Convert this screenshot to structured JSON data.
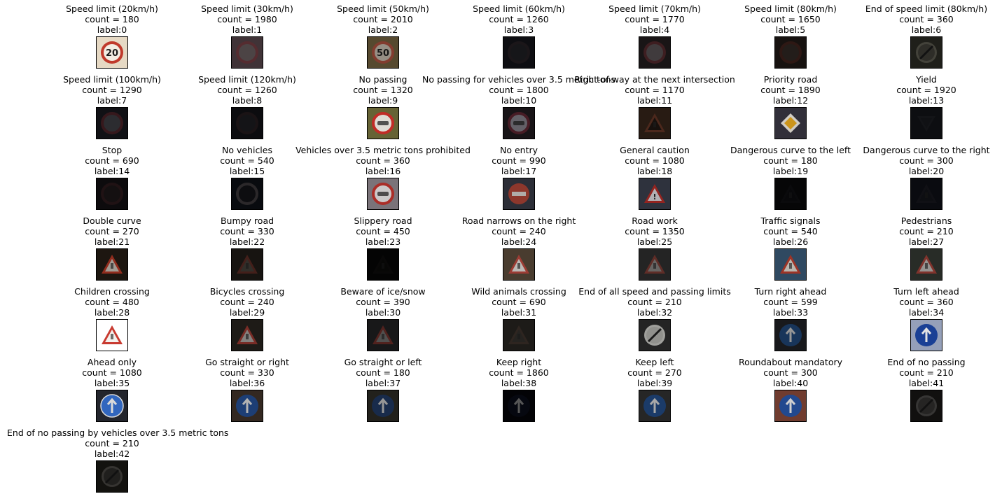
{
  "title": "",
  "columns": 7,
  "classes": [
    {
      "name": "Speed limit (20km/h)",
      "count_text": "count = 180",
      "label_text": "label:0",
      "icon": "speed-limit-sign-icon",
      "bg": "#e6d9c4",
      "fg": "#c0392b",
      "inner": "#f3ede3",
      "glyph": "20",
      "lum": 1.0
    },
    {
      "name": "Speed limit (30km/h)",
      "count_text": "count = 1980",
      "label_text": "label:1",
      "icon": "speed-limit-sign-icon",
      "bg": "#5c4a4f",
      "fg": "#7a3f46",
      "inner": "#6e6264",
      "glyph": "",
      "lum": 0.6
    },
    {
      "name": "Speed limit (50km/h)",
      "count_text": "count = 2010",
      "label_text": "label:2",
      "icon": "speed-limit-sign-icon",
      "bg": "#6b5a3a",
      "fg": "#a04a3a",
      "inner": "#b9b0a4",
      "glyph": "50",
      "lum": 0.75
    },
    {
      "name": "Speed limit (60km/h)",
      "count_text": "count = 1260",
      "label_text": "label:3",
      "icon": "speed-limit-sign-icon",
      "bg": "#1f1f26",
      "fg": "#3a2f36",
      "inner": "#2e2e35",
      "glyph": "",
      "lum": 0.3
    },
    {
      "name": "Speed limit (70km/h)",
      "count_text": "count = 1770",
      "label_text": "label:4",
      "icon": "speed-limit-sign-icon",
      "bg": "#2c2426",
      "fg": "#6a3438",
      "inner": "#6e6569",
      "glyph": "",
      "lum": 0.45
    },
    {
      "name": "Speed limit (80km/h)",
      "count_text": "count = 1650",
      "label_text": "label:5",
      "icon": "speed-limit-sign-icon",
      "bg": "#2e2420",
      "fg": "#5a2f28",
      "inner": "#453a34",
      "glyph": "",
      "lum": 0.35
    },
    {
      "name": "End of speed limit (80km/h)",
      "count_text": "count = 360",
      "label_text": "label:6",
      "icon": "end-of-speed-limit-sign-icon",
      "bg": "#3a3a30",
      "fg": "#7a786a",
      "inner": "#55524a",
      "glyph": "",
      "lum": 0.4
    },
    {
      "name": "Speed limit (100km/h)",
      "count_text": "count = 1290",
      "label_text": "label:7",
      "icon": "speed-limit-sign-icon",
      "bg": "#22232a",
      "fg": "#6b3038",
      "inner": "#56565e",
      "glyph": "",
      "lum": 0.35
    },
    {
      "name": "Speed limit (120km/h)",
      "count_text": "count = 1260",
      "label_text": "label:8",
      "icon": "speed-limit-sign-icon",
      "bg": "#1d1d22",
      "fg": "#3d2c30",
      "inner": "#2f2f35",
      "glyph": "",
      "lum": 0.25
    },
    {
      "name": "No passing",
      "count_text": "count = 1320",
      "label_text": "label:9",
      "icon": "no-passing-sign-icon",
      "bg": "#6e6b3a",
      "fg": "#d0302a",
      "inner": "#f0ece6",
      "glyph": "",
      "lum": 0.9
    },
    {
      "name": "No passing for vehicles over 3.5 metric tons",
      "count_text": "count = 1800",
      "label_text": "label:10",
      "icon": "no-passing-trucks-sign-icon",
      "bg": "#2a2228",
      "fg": "#7a3040",
      "inner": "#a8a4b0",
      "glyph": "",
      "lum": 0.45
    },
    {
      "name": "Right-of-way at the next intersection",
      "count_text": "count = 1170",
      "label_text": "label:11",
      "icon": "right-of-way-sign-icon",
      "bg": "#4a3224",
      "fg": "#8a4a34",
      "inner": "#2a1e18",
      "glyph": "",
      "lum": 0.4
    },
    {
      "name": "Priority road",
      "count_text": "count = 1890",
      "label_text": "label:12",
      "icon": "priority-road-sign-icon",
      "bg": "#3a3844",
      "fg": "#f5f0e6",
      "inner": "#f0b020",
      "glyph": "",
      "lum": 0.8
    },
    {
      "name": "Yield",
      "count_text": "count = 1920",
      "label_text": "label:13",
      "icon": "yield-sign-icon",
      "bg": "#1e2028",
      "fg": "#2c2e36",
      "inner": "#25272f",
      "glyph": "",
      "lum": 0.25
    },
    {
      "name": "Stop",
      "count_text": "count = 690",
      "label_text": "label:14",
      "icon": "stop-sign-icon",
      "bg": "#1e1a1e",
      "fg": "#4a2a2e",
      "inner": "#2e2628",
      "glyph": "",
      "lum": 0.25
    },
    {
      "name": "No vehicles",
      "count_text": "count = 540",
      "label_text": "label:15",
      "icon": "no-vehicles-sign-icon",
      "bg": "#141820",
      "fg": "#5a5458",
      "inner": "#1c1c22",
      "glyph": "",
      "lum": 0.3
    },
    {
      "name": "Vehicles over 3.5 metric tons prohibited",
      "count_text": "count = 360",
      "label_text": "label:16",
      "icon": "no-trucks-sign-icon",
      "bg": "#8a8288",
      "fg": "#c0342e",
      "inner": "#e6e2e2",
      "glyph": "",
      "lum": 0.85
    },
    {
      "name": "No entry",
      "count_text": "count = 990",
      "label_text": "label:17",
      "icon": "no-entry-sign-icon",
      "bg": "#3a3c48",
      "fg": "#b8483a",
      "inner": "#e6e0dc",
      "glyph": "",
      "lum": 0.7
    },
    {
      "name": "General caution",
      "count_text": "count = 1080",
      "label_text": "label:18",
      "icon": "caution-sign-icon",
      "bg": "#3c4250",
      "fg": "#c0302a",
      "inner": "#e8e6ea",
      "glyph": "!",
      "lum": 0.7
    },
    {
      "name": "Dangerous curve to the left",
      "count_text": "count = 180",
      "label_text": "label:19",
      "icon": "curve-left-sign-icon",
      "bg": "#121216",
      "fg": "#1c1c22",
      "inner": "#18181e",
      "glyph": "",
      "lum": 0.15
    },
    {
      "name": "Dangerous curve to the right",
      "count_text": "count = 300",
      "label_text": "label:20",
      "icon": "curve-right-sign-icon",
      "bg": "#1a1c28",
      "fg": "#2a2a36",
      "inner": "#22242e",
      "glyph": "",
      "lum": 0.2
    },
    {
      "name": "Double curve",
      "count_text": "count = 270",
      "label_text": "label:21",
      "icon": "double-curve-sign-icon",
      "bg": "#2a2018",
      "fg": "#d0402a",
      "inner": "#e8e0d4",
      "glyph": "",
      "lum": 0.6
    },
    {
      "name": "Bumpy road",
      "count_text": "count = 330",
      "label_text": "label:22",
      "icon": "bumpy-road-sign-icon",
      "bg": "#2a2620",
      "fg": "#7a3a30",
      "inner": "#5a544c",
      "glyph": "",
      "lum": 0.4
    },
    {
      "name": "Slippery road",
      "count_text": "count = 450",
      "label_text": "label:23",
      "icon": "slippery-road-sign-icon",
      "bg": "#0e0e0e",
      "fg": "#1c1a18",
      "inner": "#161614",
      "glyph": "",
      "lum": 0.12
    },
    {
      "name": "Road narrows on the right",
      "count_text": "count = 240",
      "label_text": "label:24",
      "icon": "road-narrows-sign-icon",
      "bg": "#5a4a3a",
      "fg": "#c04a40",
      "inner": "#e8e4e0",
      "glyph": "",
      "lum": 0.75
    },
    {
      "name": "Road work",
      "count_text": "count = 1350",
      "label_text": "label:25",
      "icon": "road-work-sign-icon",
      "bg": "#3a3a3a",
      "fg": "#9a4a40",
      "inner": "#a8a4a0",
      "glyph": "",
      "lum": 0.5
    },
    {
      "name": "Traffic signals",
      "count_text": "count = 540",
      "label_text": "label:26",
      "icon": "traffic-signals-sign-icon",
      "bg": "#3a5a78",
      "fg": "#c04030",
      "inner": "#e4e0d8",
      "glyph": "",
      "lum": 0.75
    },
    {
      "name": "Pedestrians",
      "count_text": "count = 210",
      "label_text": "label:27",
      "icon": "pedestrians-sign-icon",
      "bg": "#3a4038",
      "fg": "#b84a40",
      "inner": "#d8d4d0",
      "glyph": "",
      "lum": 0.6
    },
    {
      "name": "Children crossing",
      "count_text": "count = 480",
      "label_text": "label:28",
      "icon": "children-crossing-sign-icon",
      "bg": "#ffffff",
      "fg": "#c83a30",
      "inner": "#f4f2ee",
      "glyph": "",
      "lum": 1.0
    },
    {
      "name": "Bicycles crossing",
      "count_text": "count = 240",
      "label_text": "label:29",
      "icon": "bicycles-crossing-sign-icon",
      "bg": "#2e2a24",
      "fg": "#b8443a",
      "inner": "#c8c4c0",
      "glyph": "",
      "lum": 0.55
    },
    {
      "name": "Beware of ice/snow",
      "count_text": "count = 390",
      "label_text": "label:30",
      "icon": "ice-snow-sign-icon",
      "bg": "#2a2a2c",
      "fg": "#8a3a34",
      "inner": "#8a8886",
      "glyph": "",
      "lum": 0.45
    },
    {
      "name": "Wild animals crossing",
      "count_text": "count = 690",
      "label_text": "label:31",
      "icon": "wild-animals-sign-icon",
      "bg": "#3a3630",
      "fg": "#5a4a40",
      "inner": "#4a4640",
      "glyph": "",
      "lum": 0.35
    },
    {
      "name": "End of all speed and passing limits",
      "count_text": "count = 210",
      "label_text": "label:32",
      "icon": "end-of-limits-sign-icon",
      "bg": "#303030",
      "fg": "#d0d0cc",
      "inner": "#bdbdb8",
      "glyph": "",
      "lum": 0.7
    },
    {
      "name": "Turn right ahead",
      "count_text": "count = 599",
      "label_text": "label:33",
      "icon": "turn-right-sign-icon",
      "bg": "#2a2c30",
      "fg": "#2a5a9a",
      "inner": "#2a5a9a",
      "glyph": "",
      "lum": 0.45
    },
    {
      "name": "Turn left ahead",
      "count_text": "count = 360",
      "label_text": "label:34",
      "icon": "turn-left-sign-icon",
      "bg": "#a8b4d0",
      "fg": "#1e48a8",
      "inner": "#1e48a8",
      "glyph": "",
      "lum": 0.85
    },
    {
      "name": "Ahead only",
      "count_text": "count = 1080",
      "label_text": "label:35",
      "icon": "ahead-only-sign-icon",
      "bg": "#2a2c34",
      "fg": "#3a78e0",
      "inner": "#3a78e0",
      "glyph": "",
      "lum": 0.8
    },
    {
      "name": "Go straight or right",
      "count_text": "count = 330",
      "label_text": "label:36",
      "icon": "straight-or-right-sign-icon",
      "bg": "#4a3a30",
      "fg": "#2a5aa8",
      "inner": "#2a5aa8",
      "glyph": "",
      "lum": 0.6
    },
    {
      "name": "Go straight or left",
      "count_text": "count = 180",
      "label_text": "label:37",
      "icon": "straight-or-left-sign-icon",
      "bg": "#3a3830",
      "fg": "#2a4a80",
      "inner": "#2a4a80",
      "glyph": "",
      "lum": 0.45
    },
    {
      "name": "Keep right",
      "count_text": "count = 1860",
      "label_text": "label:38",
      "icon": "keep-right-sign-icon",
      "bg": "#0a0a12",
      "fg": "#141830",
      "inner": "#101426",
      "glyph": "",
      "lum": 0.12
    },
    {
      "name": "Keep left",
      "count_text": "count = 270",
      "label_text": "label:39",
      "icon": "keep-left-sign-icon",
      "bg": "#3a3a3a",
      "fg": "#2a5aa0",
      "inner": "#2a5aa0",
      "glyph": "",
      "lum": 0.55
    },
    {
      "name": "Roundabout mandatory",
      "count_text": "count = 300",
      "label_text": "label:40",
      "icon": "roundabout-sign-icon",
      "bg": "#8a4a3a",
      "fg": "#2a5ab0",
      "inner": "#2a5ab0",
      "glyph": "",
      "lum": 0.75
    },
    {
      "name": "End of no passing",
      "count_text": "count = 210",
      "label_text": "label:41",
      "icon": "end-of-no-passing-sign-icon",
      "bg": "#22201e",
      "fg": "#6a6866",
      "inner": "#4a4846",
      "glyph": "",
      "lum": 0.35
    },
    {
      "name": "End of no passing by vehicles over 3.5 metric tons",
      "count_text": "count = 210",
      "label_text": "label:42",
      "icon": "end-of-no-passing-trucks-sign-icon",
      "bg": "#26241e",
      "fg": "#6a6660",
      "inner": "#403e3a",
      "glyph": "",
      "lum": 0.35
    }
  ]
}
